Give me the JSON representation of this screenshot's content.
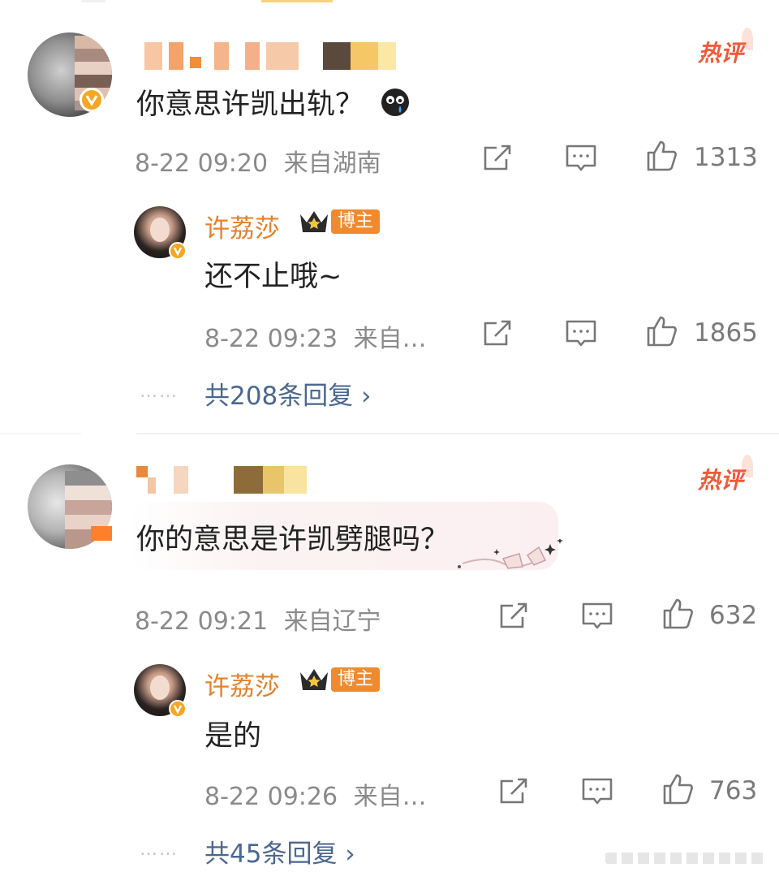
{
  "comments": [
    {
      "text": "你意思许凯出轨？",
      "hot_label": "热评",
      "time": "8-22 09:20",
      "location": "来自湖南",
      "likes": "1313",
      "reply": {
        "name": "许荔莎",
        "badge": "博主",
        "text": "还不止哦~",
        "time": "8-22 09:23",
        "location": "来自…",
        "likes": "1865"
      },
      "more_replies": "共208条回复 ›"
    },
    {
      "text": "你的意思是许凯劈腿吗？",
      "hot_label": "热评",
      "time": "8-22 09:21",
      "location": "来自辽宁",
      "likes": "632",
      "reply": {
        "name": "许荔莎",
        "badge": "博主",
        "text": "是的",
        "time": "8-22 09:26",
        "location": "来自…",
        "likes": "763"
      },
      "more_replies": "共45条回复 ›"
    }
  ],
  "more_dots": "……",
  "colors": {
    "hot": "#f05a3a",
    "name_orange": "#e5802b",
    "link_blue": "#4a6790",
    "meta_gray": "#8a8a8a",
    "badge_orange": "#f08a2e"
  },
  "icons": [
    "repost-icon",
    "comment-icon",
    "like-icon",
    "verified-icon",
    "crown-icon",
    "sob-emoji-icon"
  ]
}
